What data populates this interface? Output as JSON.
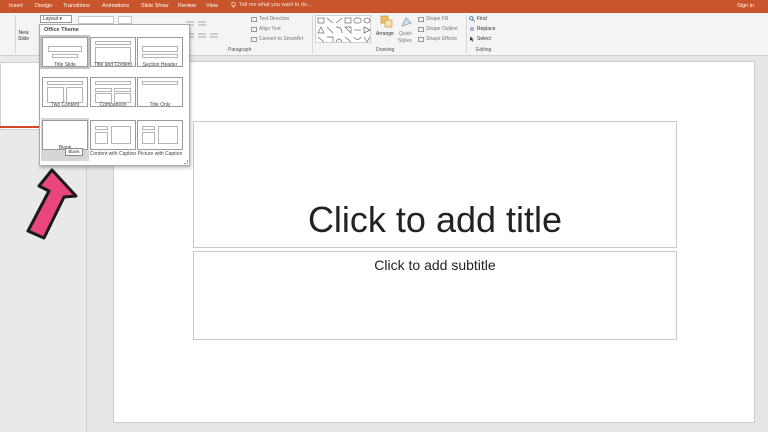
{
  "tabs": {
    "insert": "Insert",
    "design": "Design",
    "transitions": "Transitions",
    "animations": "Animations",
    "slide_show": "Slide Show",
    "review": "Review",
    "view": "View",
    "tell_me": "Tell me what you want to do...",
    "sign_in": "Sign in"
  },
  "ribbon": {
    "new_slide": "New",
    "new_slide_2": "Slide",
    "layout": "Layout",
    "paragraph_group": "Paragraph",
    "drawing_group": "Drawing",
    "editing_group": "Editing",
    "text_direction": "Text Direction",
    "align_text": "Align Text",
    "convert_smartart": "Convert to SmartArt",
    "arrange": "Arrange",
    "quick_styles": "Quick",
    "quick_styles_2": "Styles",
    "shape_fill": "Shape Fill",
    "shape_outline": "Shape Outline",
    "shape_effects": "Shape Effects",
    "find": "Find",
    "replace": "Replace",
    "select": "Select"
  },
  "gallery": {
    "title": "Office Theme",
    "layouts": [
      {
        "label": "Title Slide"
      },
      {
        "label": "Title and Content"
      },
      {
        "label": "Section Header"
      },
      {
        "label": "Two Content"
      },
      {
        "label": "Comparison"
      },
      {
        "label": "Title Only"
      },
      {
        "label": "Blank"
      },
      {
        "label": "Content with Caption"
      },
      {
        "label": "Picture with Caption"
      }
    ],
    "tooltip": "Blank"
  },
  "slide": {
    "title_placeholder": "Click to add title",
    "subtitle_placeholder": "Click to add subtitle"
  },
  "colors": {
    "accent": "#c9552d",
    "arrow_fill": "#e8467c"
  }
}
